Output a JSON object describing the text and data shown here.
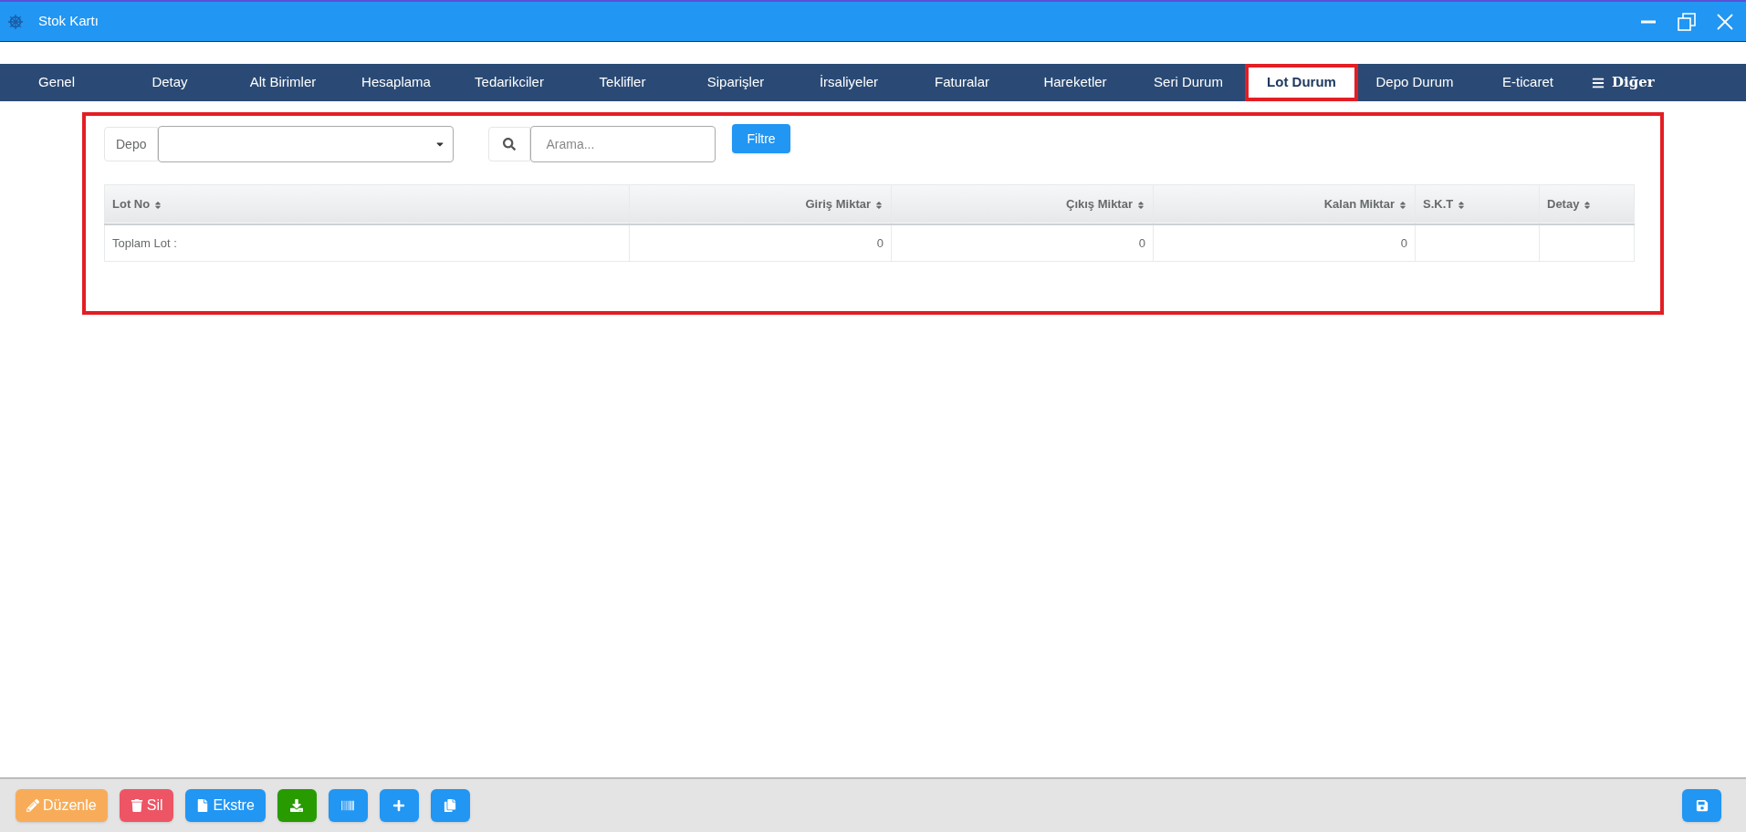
{
  "window": {
    "title": "Stok Kartı"
  },
  "tabs": [
    {
      "label": "Genel",
      "selected": false,
      "kind": "tab"
    },
    {
      "label": "Detay",
      "selected": false,
      "kind": "tab"
    },
    {
      "label": "Alt Birimler",
      "selected": false,
      "kind": "tab"
    },
    {
      "label": "Hesaplama",
      "selected": false,
      "kind": "tab"
    },
    {
      "label": "Tedarikciler",
      "selected": false,
      "kind": "tab"
    },
    {
      "label": "Teklifler",
      "selected": false,
      "kind": "tab"
    },
    {
      "label": "Siparişler",
      "selected": false,
      "kind": "tab"
    },
    {
      "label": "İrsaliyeler",
      "selected": false,
      "kind": "tab"
    },
    {
      "label": "Faturalar",
      "selected": false,
      "kind": "tab"
    },
    {
      "label": "Hareketler",
      "selected": false,
      "kind": "tab"
    },
    {
      "label": "Seri Durum",
      "selected": false,
      "kind": "tab"
    },
    {
      "label": "Lot Durum",
      "selected": true,
      "kind": "tab"
    },
    {
      "label": "Depo Durum",
      "selected": false,
      "kind": "tab"
    },
    {
      "label": "E-ticaret",
      "selected": false,
      "kind": "tab"
    },
    {
      "label": "Diğer",
      "selected": false,
      "kind": "menu"
    }
  ],
  "filters": {
    "depo_label": "Depo",
    "search_placeholder": "Arama...",
    "filter_button": "Filtre"
  },
  "table": {
    "columns": [
      {
        "label": "Lot No",
        "kind": "text"
      },
      {
        "label": "Giriş Miktar",
        "kind": "number"
      },
      {
        "label": "Çıkış Miktar",
        "kind": "number"
      },
      {
        "label": "Kalan Miktar",
        "kind": "number"
      },
      {
        "label": "S.K.T",
        "kind": "text"
      },
      {
        "label": "Detay",
        "kind": "text"
      }
    ],
    "rows": [
      [
        "Toplam Lot :",
        "0",
        "0",
        "0",
        "",
        ""
      ]
    ]
  },
  "toolbar": [
    {
      "kind": "edit",
      "label": "Düzenle"
    },
    {
      "kind": "delete",
      "label": "Sil"
    },
    {
      "kind": "extract",
      "label": "Ekstre"
    },
    {
      "kind": "download"
    },
    {
      "kind": "barcode"
    },
    {
      "kind": "add"
    },
    {
      "kind": "copy"
    }
  ],
  "save_button": {
    "kind": "save"
  }
}
